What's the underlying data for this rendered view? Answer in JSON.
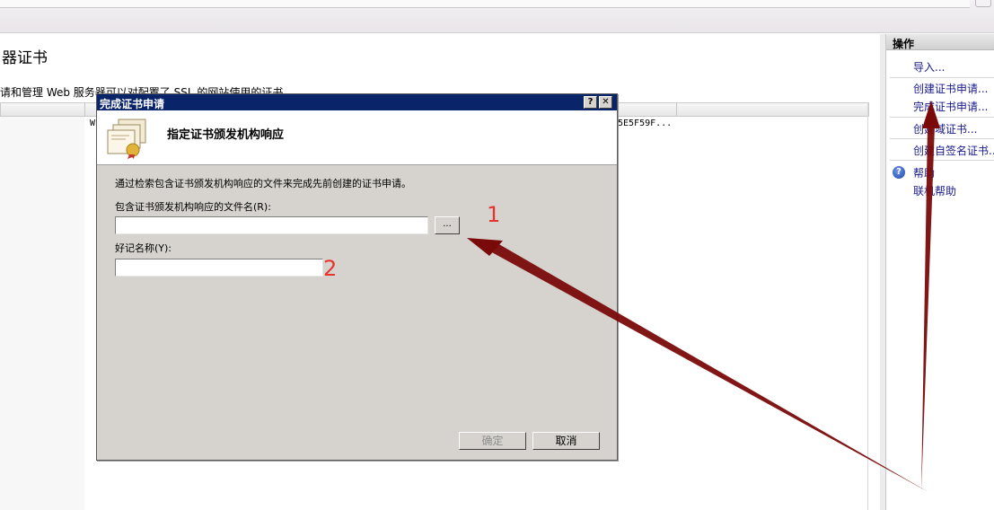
{
  "page": {
    "title": "器证书",
    "description": "请和管理 Web 服务器可以对配置了 SSL 的网站使用的证书。",
    "row_prefix": "W",
    "row_hash": "5E5F59F..."
  },
  "actions": {
    "header": "操作",
    "items": [
      {
        "label": "导入..."
      },
      {
        "label": "创建证书申请..."
      },
      {
        "label": "完成证书申请..."
      },
      {
        "label": "创建域证书..."
      },
      {
        "label": "创建自签名证书..."
      }
    ],
    "help": "帮助",
    "online_help": "联机帮助"
  },
  "dialog": {
    "title": "完成证书申请",
    "help_btn": "?",
    "close_btn": "✕",
    "banner_title": "指定证书颁发机构响应",
    "instruction": "通过检索包含证书颁发机构响应的文件来完成先前创建的证书申请。",
    "file_label": "包含证书颁发机构响应的文件名(R):",
    "file_value": "",
    "browse_label": "...",
    "friendly_label": "好记名称(Y):",
    "friendly_value": "",
    "ok_label": "确定",
    "cancel_label": "取消"
  },
  "annotations": {
    "marker1": "1",
    "marker2": "2",
    "arrow_color": "#7a0a0a",
    "marker_color": "#e8322c"
  },
  "colors": {
    "titlebar": "#0a246a",
    "dialog_face": "#d6d3ce",
    "link": "#1a1a8c"
  }
}
